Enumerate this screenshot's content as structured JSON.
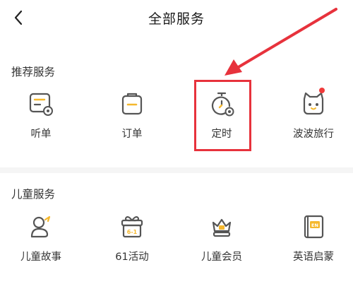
{
  "header": {
    "title": "全部服务",
    "back_icon": "chevron-left-icon"
  },
  "recommended": {
    "title": "推荐服务",
    "items": [
      {
        "label": "听单",
        "icon": "listen-list-icon"
      },
      {
        "label": "订单",
        "icon": "order-clipboard-icon"
      },
      {
        "label": "定时",
        "icon": "timer-icon"
      },
      {
        "label": "波波旅行",
        "icon": "cat-travel-icon",
        "has_red_dot": true
      }
    ]
  },
  "children": {
    "title": "儿童服务",
    "items": [
      {
        "label": "儿童故事",
        "icon": "child-story-icon"
      },
      {
        "label": "61活动",
        "icon": "gift-61-icon"
      },
      {
        "label": "儿童会员",
        "icon": "crown-vip-icon"
      },
      {
        "label": "英语启蒙",
        "icon": "english-book-icon"
      }
    ]
  },
  "colors": {
    "accent_yellow": "#f5b82e",
    "icon_gray": "#555555",
    "annotation_red": "#e7323c",
    "red_dot": "#f03a3a"
  }
}
